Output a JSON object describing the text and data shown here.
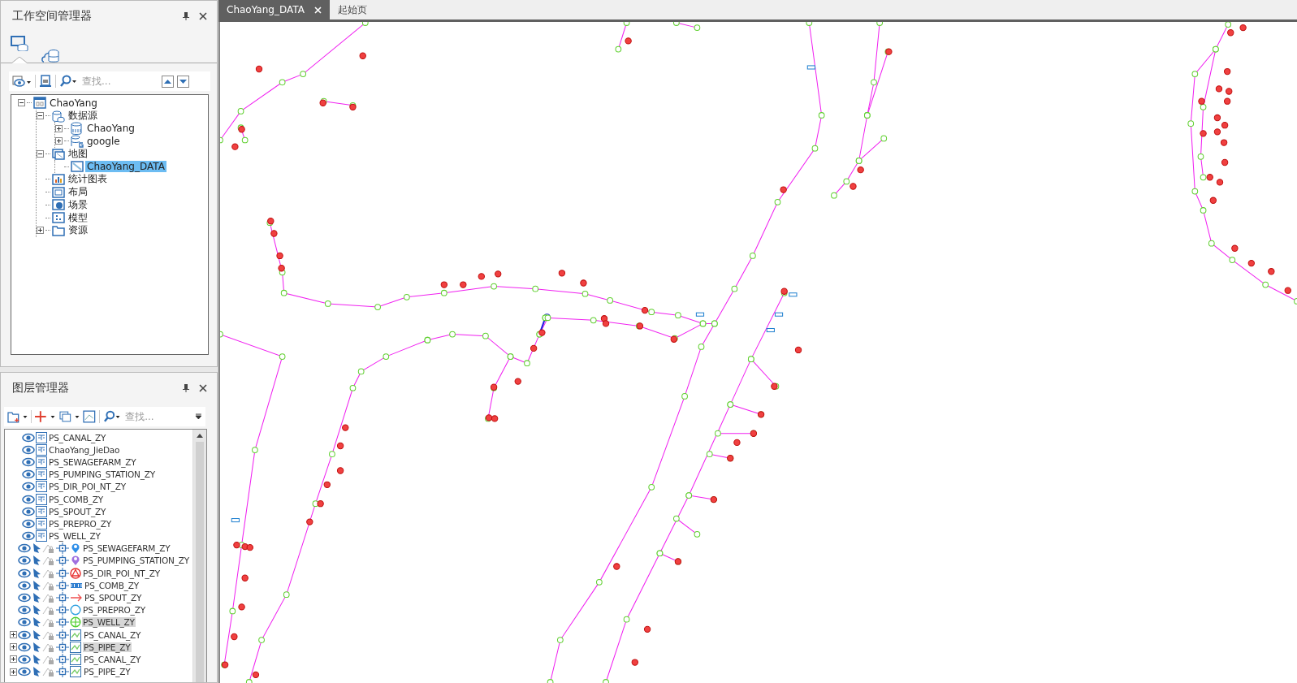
{
  "workspace_panel": {
    "title": "工作空间管理器",
    "view_tabs": [
      {
        "kind": "local",
        "selected": true
      },
      {
        "kind": "cloud",
        "selected": false
      }
    ],
    "search": {
      "placeholder": "查找..."
    },
    "tree": [
      {
        "label": "ChaoYang",
        "kind": "workspace",
        "expanded": true,
        "selected": false,
        "children": [
          {
            "label": "数据源",
            "kind": "datasources",
            "expanded": true,
            "selected": false,
            "children": [
              {
                "label": "ChaoYang",
                "kind": "udb",
                "expanded": false,
                "selected": false
              },
              {
                "label": "google",
                "kind": "google",
                "expanded": false,
                "selected": false
              }
            ]
          },
          {
            "label": "地图",
            "kind": "maps",
            "expanded": true,
            "selected": false,
            "children": [
              {
                "label": "ChaoYang_DATA",
                "kind": "map",
                "selected": true
              }
            ]
          },
          {
            "label": "统计图表",
            "kind": "chart",
            "selected": false
          },
          {
            "label": "布局",
            "kind": "layout",
            "selected": false
          },
          {
            "label": "场景",
            "kind": "scene",
            "selected": false
          },
          {
            "label": "模型",
            "kind": "model",
            "selected": false
          },
          {
            "label": "资源",
            "kind": "resources",
            "expanded": false,
            "selected": false
          }
        ]
      }
    ]
  },
  "layer_panel": {
    "title": "图层管理器",
    "search": {
      "placeholder": "查找..."
    },
    "layers": [
      {
        "label": "PS_CANAL_ZY",
        "kind": "table",
        "selected": false
      },
      {
        "label": "ChaoYang_JieDao",
        "kind": "table",
        "selected": false
      },
      {
        "label": "PS_SEWAGEFARM_ZY",
        "kind": "table",
        "selected": false
      },
      {
        "label": "PS_PUMPING_STATION_ZY",
        "kind": "table",
        "selected": false
      },
      {
        "label": "PS_DIR_POI_NT_ZY",
        "kind": "table",
        "selected": false
      },
      {
        "label": "PS_COMB_ZY",
        "kind": "table",
        "selected": false
      },
      {
        "label": "PS_SPOUT_ZY",
        "kind": "table",
        "selected": false
      },
      {
        "label": "PS_PREPRO_ZY",
        "kind": "table",
        "selected": false
      },
      {
        "label": "PS_WELL_ZY",
        "kind": "table",
        "selected": false
      },
      {
        "label": "PS_SEWAGEFARM_ZY",
        "kind": "vector",
        "symbol": {
          "kind": "pin",
          "color": "#2f8fe8"
        },
        "selected": false
      },
      {
        "label": "PS_PUMPING_STATION_ZY",
        "kind": "vector",
        "symbol": {
          "kind": "pin",
          "color": "#a070e0"
        },
        "selected": false
      },
      {
        "label": "PS_DIR_POI_NT_ZY",
        "kind": "vector",
        "symbol": {
          "kind": "triangle",
          "color": "#e83030"
        },
        "selected": false
      },
      {
        "label": "PS_COMB_ZY",
        "kind": "vector",
        "symbol": {
          "kind": "comb",
          "color": "#2f7fd0"
        },
        "selected": false
      },
      {
        "label": "PS_SPOUT_ZY",
        "kind": "vector",
        "symbol": {
          "kind": "arrow",
          "color": "#f05050"
        },
        "selected": false
      },
      {
        "label": "PS_PREPRO_ZY",
        "kind": "vector",
        "symbol": {
          "kind": "circle",
          "color": "#30a0e0"
        },
        "selected": false
      },
      {
        "label": "PS_WELL_ZY",
        "kind": "vector",
        "symbol": {
          "kind": "crosshair",
          "color": "#50d030"
        },
        "selected": true
      },
      {
        "label": "PS_CANAL_ZY",
        "kind": "vector",
        "symbol": {
          "kind": "line",
          "color": "#3070b0"
        },
        "selected": false,
        "expanded": false
      },
      {
        "label": "PS_PIPE_ZY",
        "kind": "vector",
        "symbol": {
          "kind": "line",
          "color": "#3070b0"
        },
        "selected": true,
        "expanded": false
      },
      {
        "label": "PS_CANAL_ZY",
        "kind": "vector",
        "symbol": {
          "kind": "line",
          "color": "#3070b0"
        },
        "selected": false,
        "expanded": false
      },
      {
        "label": "PS_PIPE_ZY",
        "kind": "vector",
        "symbol": {
          "kind": "line",
          "color": "#3070b0"
        },
        "selected": false,
        "expanded": false
      }
    ]
  },
  "document_tabs": [
    {
      "label": "ChaoYang_DATA",
      "selected": true
    },
    {
      "label": "起始页",
      "selected": false
    }
  ]
}
